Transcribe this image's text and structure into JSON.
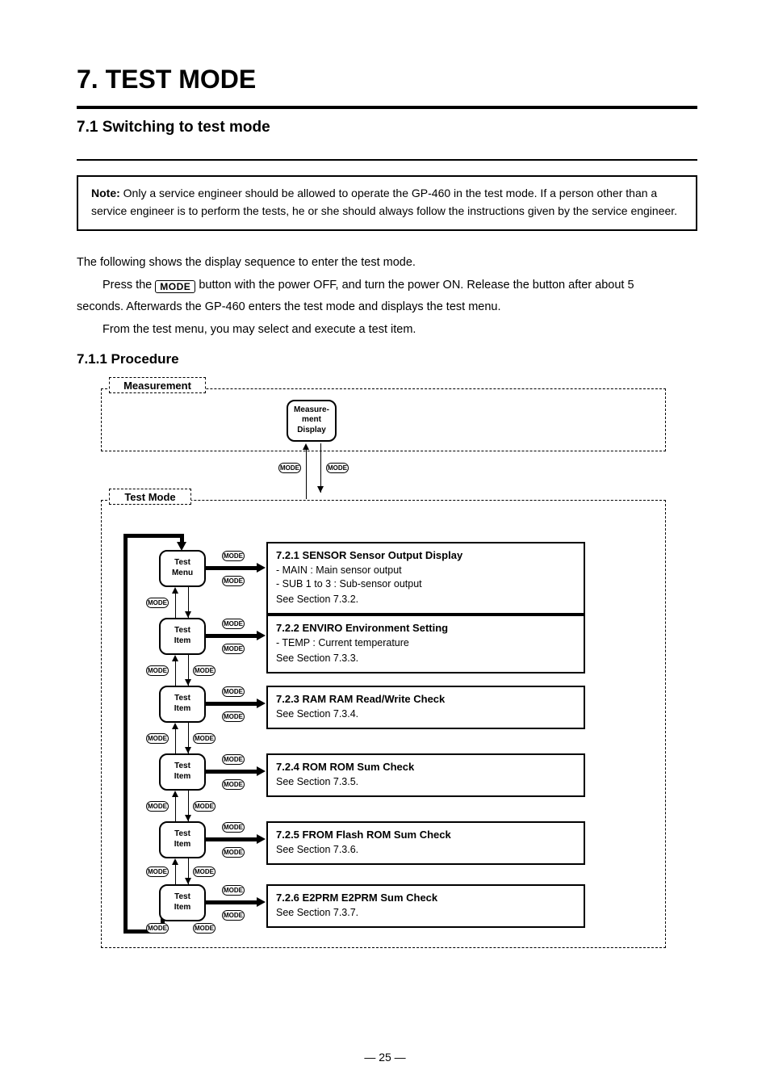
{
  "title": "7. TEST MODE",
  "subtitle": "7.1 Switching to test mode",
  "note": {
    "label": "Note:",
    "body": "Only a service engineer should be allowed to operate the GP-460 in the test mode. If a person other than a service engineer is to perform the tests, he or she should always follow the instructions given by the service engineer."
  },
  "intro1": "The following shows the display sequence to enter the test mode.",
  "intro2a": "Press the ",
  "intro2b_btn": "MODE",
  "intro2c": " button with the power OFF, and turn the power ON. Release the button after about 5",
  "intro3": "seconds. Afterwards the GP-460 enters the test mode and displays the test menu.",
  "intro4": "From the test menu, you may select and execute a test item.",
  "diag_caption": "7.1.1 Procedure",
  "tab_measure": "Measurement",
  "tab_test": "Test Mode",
  "disp_meas": [
    "Measure-",
    "ment",
    "Display"
  ],
  "pill_text": "MODE",
  "items": [
    {
      "disp": [
        "Test",
        "Menu"
      ],
      "title": "7.2.1 SENSOR Sensor Output Display",
      "rows": [
        "- MAIN : Main sensor output",
        "- SUB 1 to 3 : Sub-sensor output"
      ],
      "note": "See Section 7.3.2."
    },
    {
      "disp": [
        "Test",
        "Item"
      ],
      "title": "7.2.2 ENVIRO Environment Setting",
      "rows": [
        "- TEMP : Current temperature"
      ],
      "note": "See Section 7.3.3."
    },
    {
      "disp": [
        "Test",
        "Item"
      ],
      "title": "7.2.3 RAM RAM Read/Write Check",
      "rows": [],
      "note": "See Section 7.3.4."
    },
    {
      "disp": [
        "Test",
        "Item"
      ],
      "title": "7.2.4 ROM ROM Sum Check",
      "rows": [],
      "note": "See Section 7.3.5."
    },
    {
      "disp": [
        "Test",
        "Item"
      ],
      "title": "7.2.5 FROM Flash ROM Sum Check",
      "rows": [],
      "note": "See Section 7.3.6."
    },
    {
      "disp": [
        "Test",
        "Item"
      ],
      "title": "7.2.6 E2PRM E2PRM Sum Check",
      "rows": [],
      "note": "See Section 7.3.7."
    }
  ],
  "page": "— 25 —"
}
